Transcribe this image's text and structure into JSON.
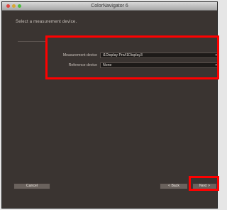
{
  "window": {
    "title": "ColorNavigator 6"
  },
  "instruction": "Select a measurement device.",
  "fields": [
    {
      "label": "Measurement device",
      "value": "i1Display Pro/i1Display3"
    },
    {
      "label": "Reference device",
      "value": "None"
    }
  ],
  "buttons": {
    "cancel": "Cancel",
    "back": "< Back",
    "next": "Next >"
  },
  "highlight_color": "#ff0000"
}
